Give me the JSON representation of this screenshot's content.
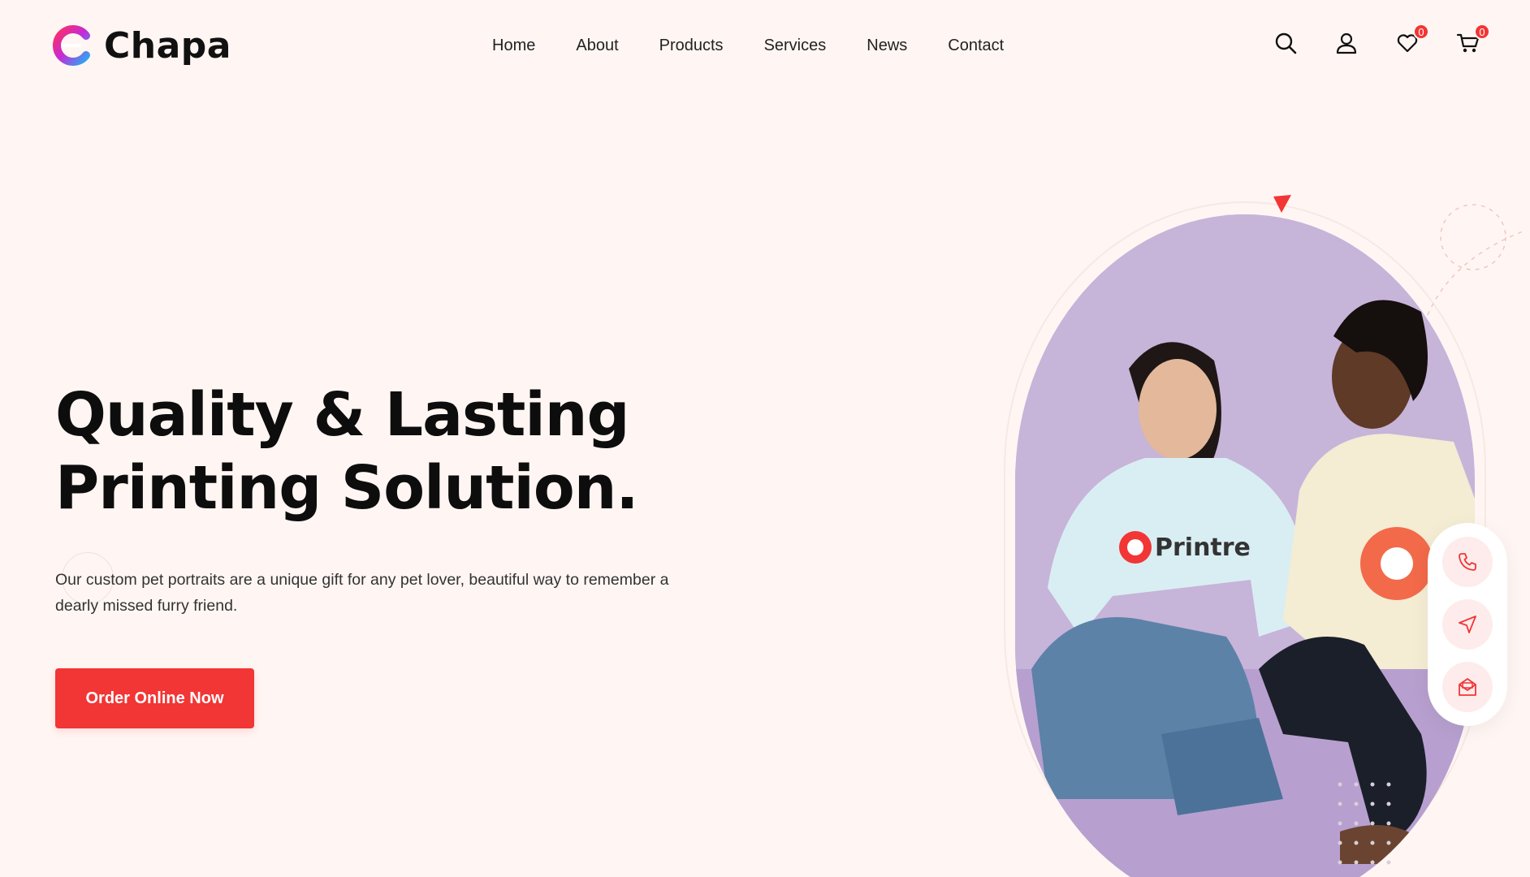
{
  "brand": {
    "name": "Chapa"
  },
  "nav": {
    "items": [
      "Home",
      "About",
      "Products",
      "Services",
      "News",
      "Contact"
    ]
  },
  "header_icons": {
    "search": "search-icon",
    "account": "user-icon",
    "wishlist": {
      "icon": "heart-icon",
      "count": "0"
    },
    "cart": {
      "icon": "cart-icon",
      "count": "0"
    }
  },
  "hero": {
    "title_line1": "Quality & Lasting",
    "title_line2": "Printing Solution.",
    "description": "Our custom pet portraits are a unique gift for any pet lover, beautiful way to remember a dearly missed furry friend.",
    "cta_label": "Order Online Now"
  },
  "visual": {
    "shirt_text": "Printre"
  },
  "contact_actions": [
    "phone-icon",
    "navigation-icon",
    "mail-icon"
  ],
  "colors": {
    "accent": "#f23535",
    "background": "#fff6f3",
    "photo_bg": "#c7b4d9"
  }
}
